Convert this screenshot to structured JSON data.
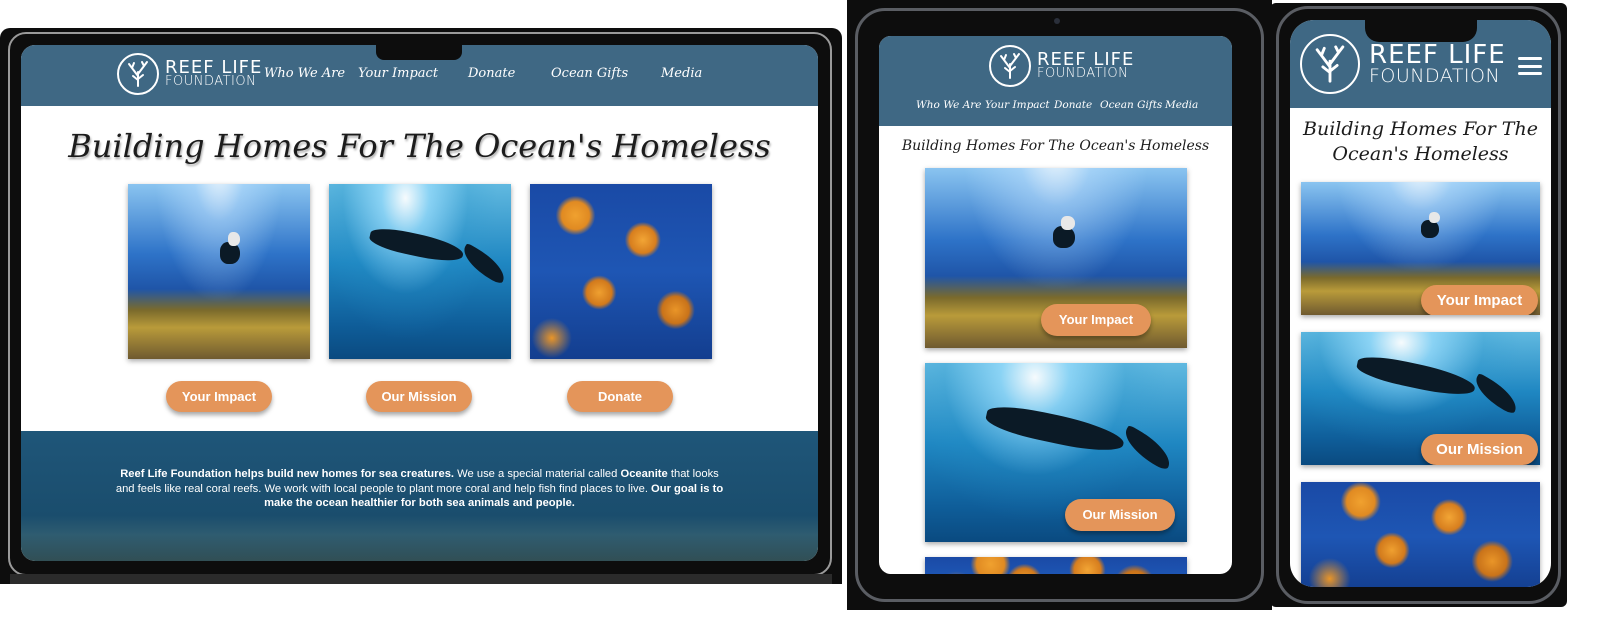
{
  "brand": {
    "name_line1": "REEF LIFE",
    "name_line2": "FOUNDATION"
  },
  "nav": {
    "items": [
      "Who We Are",
      "Your Impact",
      "Donate",
      "Ocean Gifts",
      "Media"
    ]
  },
  "hero_title": "Building Homes For The Ocean's Homeless",
  "hero_title_mobile_line1": "Building Homes For The",
  "hero_title_mobile_line2": "Ocean's Homeless",
  "buttons": {
    "impact": "Your Impact",
    "mission": "Our Mission",
    "donate": "Donate"
  },
  "info": {
    "bold1": "Reef Life Foundation helps build new homes for sea creatures.",
    "text1": " We use a special material called ",
    "bold2": "Oceanite",
    "text2": " that looks and feels like real coral reefs. We work with local people to plant more coral and help fish find places to live. ",
    "bold3": "Our goal is to make the ocean healthier for both sea animals and people."
  },
  "colors": {
    "nav": "#3f6884",
    "button": "#e4955a",
    "info_bg": "#1f5679",
    "frame": "#111111"
  },
  "icons": [
    "coral-logo-icon",
    "hamburger-menu-icon"
  ]
}
